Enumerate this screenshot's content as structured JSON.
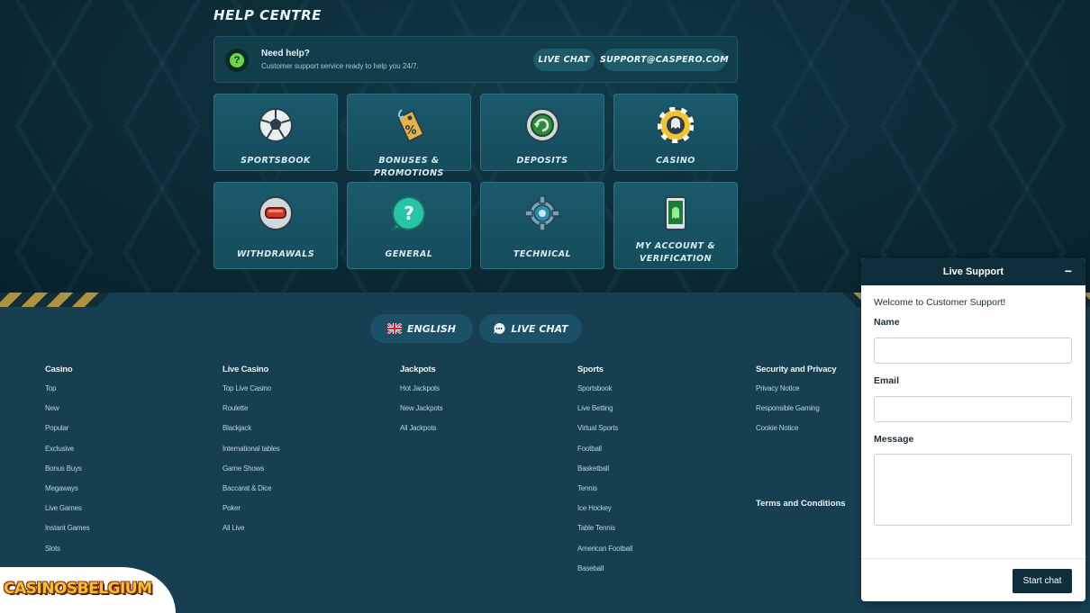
{
  "help": {
    "title": "HELP CENTRE",
    "need_help": "Need help?",
    "subtitle": "Customer support service ready to help you 24/7.",
    "live_chat_btn": "LIVE CHAT",
    "email_btn": "SUPPORT@CASPERO.COM"
  },
  "tiles": [
    {
      "label": "SPORTSBOOK",
      "icon": "soccer-ball-icon"
    },
    {
      "label": "BONUSES & PROMOTIONS",
      "icon": "percent-tag-icon"
    },
    {
      "label": "DEPOSITS",
      "icon": "deposit-coin-icon"
    },
    {
      "label": "CASINO",
      "icon": "casino-chip-icon"
    },
    {
      "label": "WITHDRAWALS",
      "icon": "withdraw-button-icon"
    },
    {
      "label": "GENERAL",
      "icon": "question-bubble-icon"
    },
    {
      "label": "TECHNICAL",
      "icon": "gear-icon"
    },
    {
      "label": "MY ACCOUNT &",
      "label2": "VERIFICATION",
      "icon": "account-tablet-icon"
    }
  ],
  "footer": {
    "language_btn": "ENGLISH",
    "live_chat_btn": "LIVE CHAT",
    "columns": [
      {
        "heading": "Casino",
        "links": [
          "Top",
          "New",
          "Popular",
          "Exclusive",
          "Bonus Buys",
          "Megaways",
          "Live Games",
          "Instant Games",
          "Slots"
        ]
      },
      {
        "heading": "Live Casino",
        "links": [
          "Top Live Casino",
          "Roulette",
          "Blackjack",
          "International tables",
          "Game Shows",
          "Baccarat & Dice",
          "Poker",
          "All Live"
        ]
      },
      {
        "heading": "Jackpots",
        "links": [
          "Hot Jackpots",
          "New Jackpots",
          "All Jackpots"
        ]
      },
      {
        "heading": "Sports",
        "links": [
          "Sportsbook",
          "Live Betting",
          "Virtual Sports",
          "Football",
          "Basketball",
          "Tennis",
          "Ice Hockey",
          "Table Tennis",
          "American Football",
          "Baseball"
        ]
      },
      {
        "heading": "Security and Privacy",
        "links": [
          "Privacy Notice",
          "Responsible Gaming",
          "Cookie Notice"
        ]
      }
    ],
    "terms": "Terms and Conditions"
  },
  "badge": {
    "text": "CASINOSBELGIUM"
  },
  "chat": {
    "title": "Live Support",
    "minimize": "−",
    "welcome": "Welcome to Customer Support!",
    "name_label": "Name",
    "email_label": "Email",
    "message_label": "Message",
    "start_label": "Start chat"
  },
  "colors": {
    "accent_green": "#6cd44a",
    "dark_navy": "#0e2e3b",
    "stripe_yellow": "#c9a23a"
  }
}
